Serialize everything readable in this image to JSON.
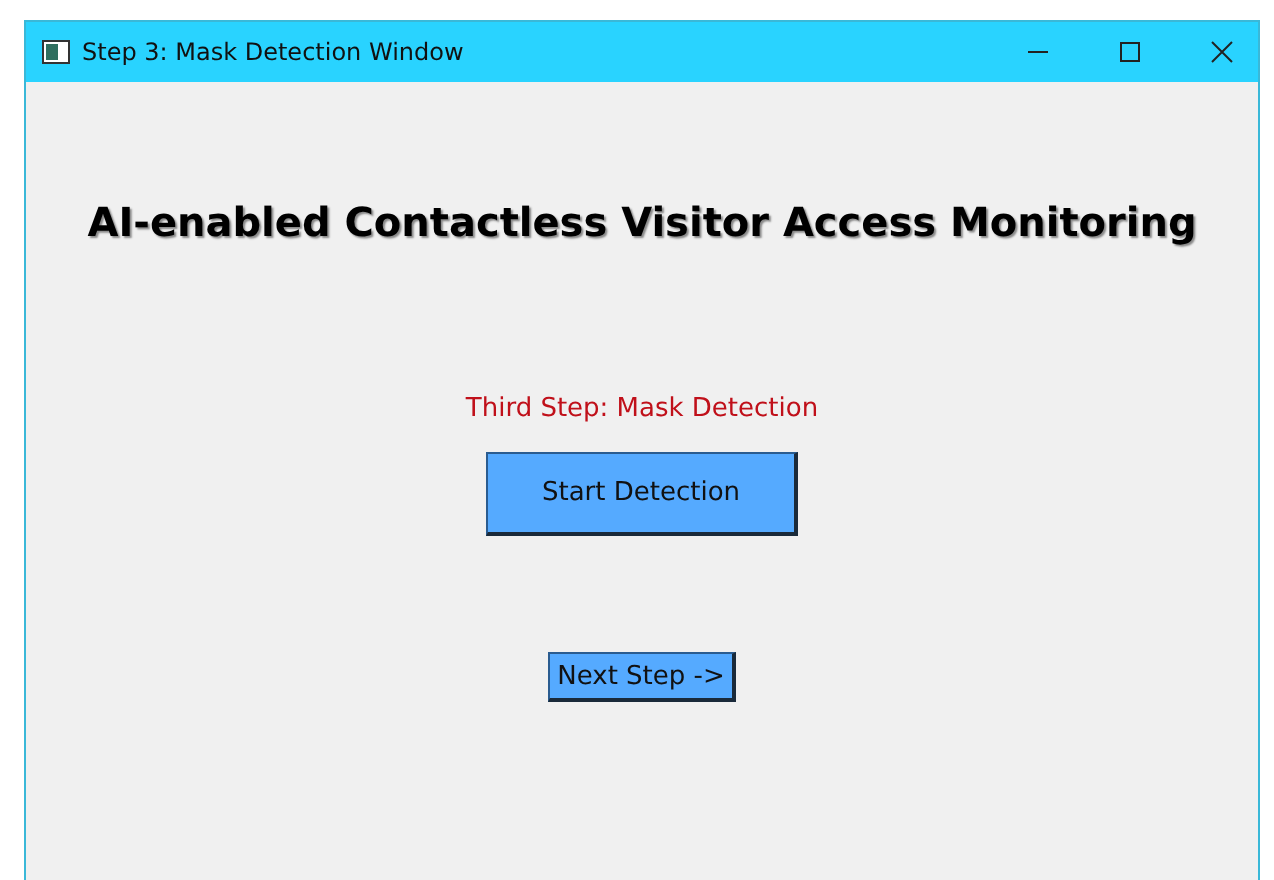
{
  "window": {
    "title": "Step 3: Mask Detection Window"
  },
  "heading": "AI-enabled Contactless Visitor Access Monitoring",
  "step_label": "Third Step: Mask Detection",
  "buttons": [
    {
      "label": "Start Detection",
      "kind": "primary"
    },
    {
      "label": "Next Step ->",
      "kind": "small"
    }
  ]
}
